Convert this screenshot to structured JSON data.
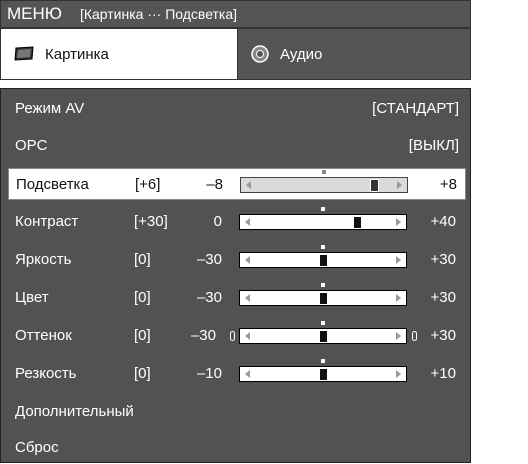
{
  "title": {
    "menu": "МЕНЮ",
    "breadcrumb": "[Картинка ··· Подсветка]"
  },
  "tabs": [
    {
      "label": "Картинка",
      "icon": "picture-icon",
      "active": true
    },
    {
      "label": "Аудио",
      "icon": "speaker-icon",
      "active": false
    }
  ],
  "items": [
    {
      "label": "Режим AV",
      "value": "[СТАНДАРТ]"
    },
    {
      "label": "OPC",
      "value": "[ВЫКЛ]"
    },
    {
      "label": "Подсветка",
      "bracket": "[+6]",
      "min": "–8",
      "max": "+8",
      "level": 6,
      "range": [
        -8,
        8
      ],
      "selected": true
    },
    {
      "label": "Контраст",
      "bracket": "[+30]",
      "min": "0",
      "max": "+40",
      "level": 30,
      "range": [
        0,
        40
      ]
    },
    {
      "label": "Яркость",
      "bracket": "[0]",
      "min": "–30",
      "max": "+30",
      "level": 0,
      "range": [
        -30,
        30
      ]
    },
    {
      "label": "Цвет",
      "bracket": "[0]",
      "min": "–30",
      "max": "+30",
      "level": 0,
      "range": [
        -30,
        30
      ]
    },
    {
      "label": "Оттенок",
      "bracket": "[0]",
      "min": "–30",
      "max": "+30",
      "level": 0,
      "range": [
        -30,
        30
      ],
      "side_markers": true
    },
    {
      "label": "Резкость",
      "bracket": "[0]",
      "min": "–10",
      "max": "+10",
      "level": 0,
      "range": [
        -10,
        10
      ]
    },
    {
      "label": "Дополнительный"
    },
    {
      "label": "Сброс"
    }
  ],
  "colors": {
    "panel": "#525252",
    "title_bar": "#555555",
    "selected_row": "#ffffff"
  }
}
